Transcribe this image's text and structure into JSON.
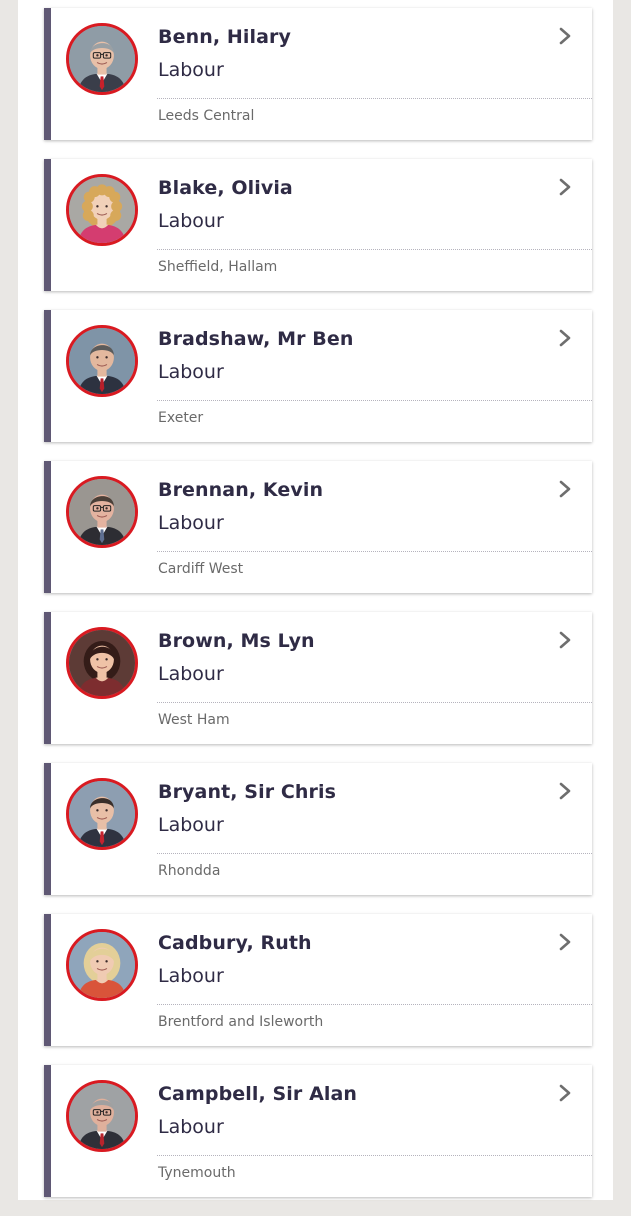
{
  "members": [
    {
      "name": "Benn, Hilary",
      "party": "Labour",
      "constituency": "Leeds Central",
      "photo": {
        "bg": "#8f9ca6",
        "skin": "#e8c0a8",
        "hair": "#9aa0a4",
        "jacket": "#3a3e4a",
        "shirt": "#ffffff",
        "tie": "#c8202a",
        "hair_style": "short",
        "glasses": true
      }
    },
    {
      "name": "Blake, Olivia",
      "party": "Labour",
      "constituency": "Sheffield, Hallam",
      "photo": {
        "bg": "#a9a8a4",
        "skin": "#f1d1b9",
        "hair": "#d7a85a",
        "jacket": "#d43d70",
        "shirt": "#d43d70",
        "tie": "",
        "hair_style": "curly",
        "glasses": false
      }
    },
    {
      "name": "Bradshaw, Mr Ben",
      "party": "Labour",
      "constituency": "Exeter",
      "photo": {
        "bg": "#7f94a7",
        "skin": "#e3b89e",
        "hair": "#5b5b5b",
        "jacket": "#2d3240",
        "shirt": "#ffffff",
        "tie": "#b81f2a",
        "hair_style": "short",
        "glasses": false
      }
    },
    {
      "name": "Brennan, Kevin",
      "party": "Labour",
      "constituency": "Cardiff West",
      "photo": {
        "bg": "#9a9691",
        "skin": "#e4b3a0",
        "hair": "#4a3f38",
        "jacket": "#2d2d33",
        "shirt": "#ffffff",
        "tie": "#5f6f91",
        "hair_style": "short",
        "glasses": true
      }
    },
    {
      "name": "Brown, Ms Lyn",
      "party": "Labour",
      "constituency": "West Ham",
      "photo": {
        "bg": "#5d3b36",
        "skin": "#efc2a6",
        "hair": "#341c18",
        "jacket": "#7d2d2f",
        "shirt": "#7d2d2f",
        "tie": "",
        "hair_style": "bob",
        "glasses": false
      }
    },
    {
      "name": "Bryant, Sir Chris",
      "party": "Labour",
      "constituency": "Rhondda",
      "photo": {
        "bg": "#8d9eb1",
        "skin": "#e8bfa7",
        "hair": "#3a2f2a",
        "jacket": "#2f3240",
        "shirt": "#ffffff",
        "tie": "#c4232f",
        "hair_style": "short",
        "glasses": false
      }
    },
    {
      "name": "Cadbury, Ruth",
      "party": "Labour",
      "constituency": "Brentford and Isleworth",
      "photo": {
        "bg": "#8fa5bb",
        "skin": "#f0cbb3",
        "hair": "#e3cf98",
        "jacket": "#d9543a",
        "shirt": "#d9543a",
        "tie": "",
        "hair_style": "bob",
        "glasses": false
      }
    },
    {
      "name": "Campbell, Sir Alan",
      "party": "Labour",
      "constituency": "Tynemouth",
      "photo": {
        "bg": "#9fa2a4",
        "skin": "#dfb09c",
        "hair": "#a0a0a0",
        "jacket": "#2e3038",
        "shirt": "#ffffff",
        "tie": "#b8242c",
        "hair_style": "short",
        "glasses": true
      }
    }
  ],
  "icons": {
    "chevron": "chevron-right-icon"
  },
  "colors": {
    "accent_bar": "#5f5874",
    "photo_ring": "#d91a21",
    "name_text": "#2f2b45",
    "constituency_text": "#6a6a6a"
  }
}
